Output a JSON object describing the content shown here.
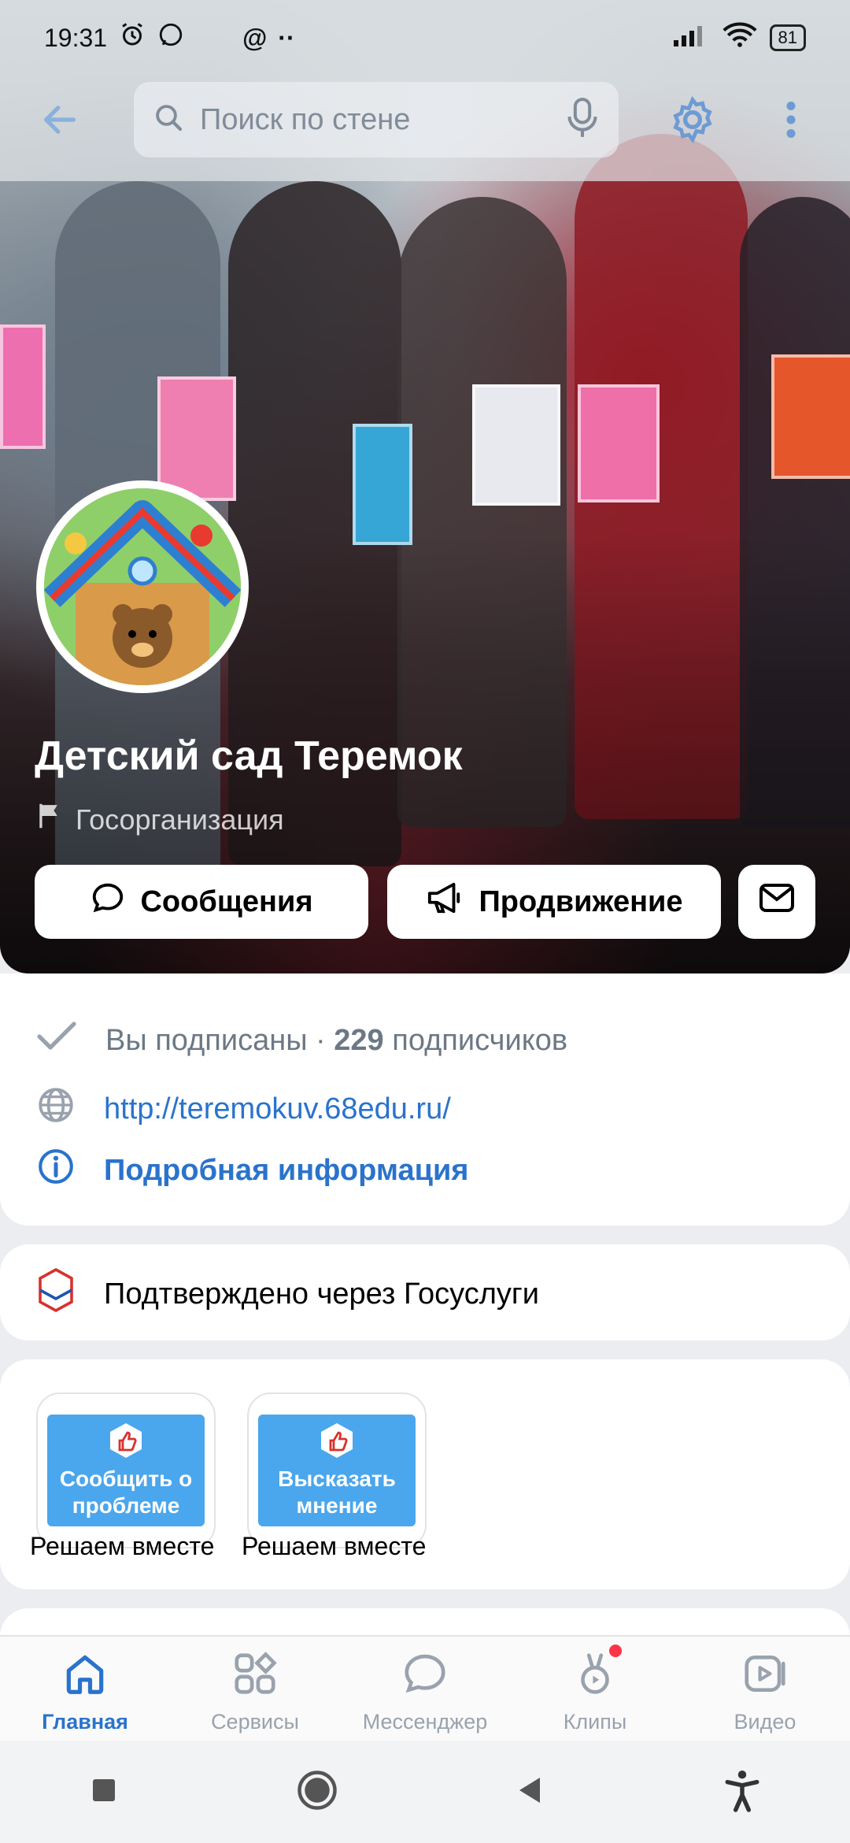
{
  "status_bar": {
    "time": "19:31",
    "battery": "81",
    "icons": [
      "alarm-icon",
      "whatsapp-icon",
      "at-icon",
      "more-dots-icon",
      "signal-icon",
      "wifi-icon",
      "battery-icon"
    ]
  },
  "top_bar": {
    "search_placeholder": "Поиск по стене",
    "icons": [
      "back-arrow-icon",
      "search-icon",
      "microphone-icon",
      "gear-icon",
      "more-vertical-icon"
    ]
  },
  "group": {
    "name": "Детский сад Теремок",
    "category": "Госорганизация"
  },
  "actions": {
    "messages_label": "Сообщения",
    "promotion_label": "Продвижение"
  },
  "info": {
    "subscribed_text": "Вы подписаны · ",
    "subscriber_count": "229",
    "subscribers_word": " подписчиков",
    "website": "http://teremokuv.68edu.ru/",
    "details_link": "Подробная информация"
  },
  "verified": {
    "text": "Подтверждено через Госуслуги",
    "badge_text": "гос услуги"
  },
  "apps": [
    {
      "tile_text": "Сообщить о проблеме",
      "label": "Решаем вместе"
    },
    {
      "tile_text": "Высказать мнение",
      "label": "Решаем вместе"
    }
  ],
  "tabs": [
    {
      "label": "Главная",
      "icon": "home-icon",
      "active": true
    },
    {
      "label": "Сервисы",
      "icon": "services-icon",
      "active": false
    },
    {
      "label": "Мессенджер",
      "icon": "messenger-icon",
      "active": false
    },
    {
      "label": "Клипы",
      "icon": "clips-icon",
      "active": false,
      "has_badge": true
    },
    {
      "label": "Видео",
      "icon": "video-icon",
      "active": false
    }
  ],
  "colors": {
    "accent": "#2a73cc",
    "badge_red": "#ff3347",
    "app_blue": "#4aa6ed"
  }
}
